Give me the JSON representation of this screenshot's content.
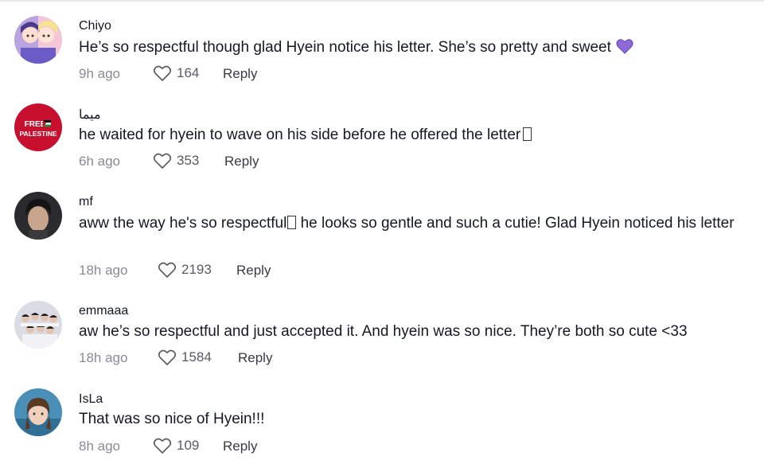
{
  "comments": [
    {
      "username": "Chiyo",
      "text": "He’s so respectful though glad Hyein notice his letter. She’s so pretty and sweet",
      "emoji": "purple-heart",
      "time": "9h ago",
      "likes": "164",
      "reply_label": "Reply"
    },
    {
      "username": "ميما",
      "text": "he waited for hyein to wave on his side before he offered the letter",
      "emoji": "missing-glyph",
      "time": "6h ago",
      "likes": "353",
      "reply_label": "Reply",
      "avatar_text_1": "FREE",
      "avatar_text_2": "PALESTINE"
    },
    {
      "username": "mf",
      "text_part1": "aww the way he's so respectful",
      "text_part2": " he looks so gentle and such a cutie! Glad Hyein noticed his letter",
      "emoji": "missing-glyph",
      "time": "18h ago",
      "likes": "2193",
      "reply_label": "Reply"
    },
    {
      "username": "emmaaa",
      "text": "aw he’s so respectful and just accepted it. And hyein was so nice. They’re both so cute <33",
      "time": "18h ago",
      "likes": "1584",
      "reply_label": "Reply"
    },
    {
      "username": "IsLa",
      "text": "That was so nice of Hyein!!!",
      "time": "8h ago",
      "likes": "109",
      "reply_label": "Reply"
    }
  ],
  "icons": {
    "like": "heart-outline-icon",
    "emoji": "purple-heart-emoji"
  },
  "colors": {
    "text": "#161823",
    "muted": "#8a8b91",
    "emoji_purple": "#8e6ad8",
    "avatar_red": "#c8102e"
  }
}
